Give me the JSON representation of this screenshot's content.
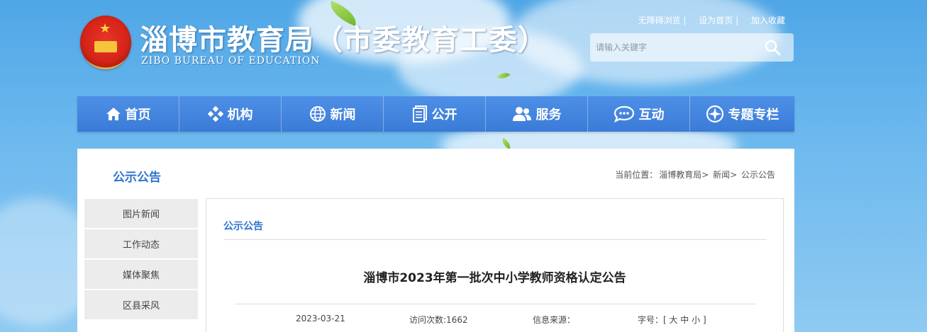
{
  "header": {
    "title_cn": "淄博市教育局（市委教育工委）",
    "title_en": "ZIBO BUREAU OF EDUCATION",
    "links": [
      "无障碍浏览 |",
      "设为首页 |",
      "加入收藏"
    ]
  },
  "search": {
    "placeholder": "请输入关键字"
  },
  "nav": {
    "items": [
      {
        "label": "首页",
        "icon": "home-icon"
      },
      {
        "label": "机构",
        "icon": "organization-icon"
      },
      {
        "label": "新闻",
        "icon": "globe-icon"
      },
      {
        "label": "公开",
        "icon": "document-icon"
      },
      {
        "label": "服务",
        "icon": "people-icon"
      },
      {
        "label": "互动",
        "icon": "chat-icon"
      },
      {
        "label": "专题专栏",
        "icon": "compass-icon"
      }
    ]
  },
  "section": {
    "title": "公示公告"
  },
  "breadcrumb": {
    "prefix": "当前位置：",
    "items": [
      "淄博教育局>",
      "新闻>",
      "公示公告"
    ]
  },
  "sidebar": {
    "items": [
      "图片新闻",
      "工作动态",
      "媒体聚焦",
      "区县采风"
    ]
  },
  "panel": {
    "title": "公示公告"
  },
  "article": {
    "title": "淄博市2023年第一批次中小学教师资格认定公告",
    "date": "2023-03-21",
    "views": "访问次数:1662",
    "source": "信息来源：",
    "font_size": "字号：[ 大 中 小 ]"
  },
  "colors": {
    "nav_bg": "#3a7bd8",
    "accent": "#2f73d0",
    "sky": "#5aaceb"
  }
}
